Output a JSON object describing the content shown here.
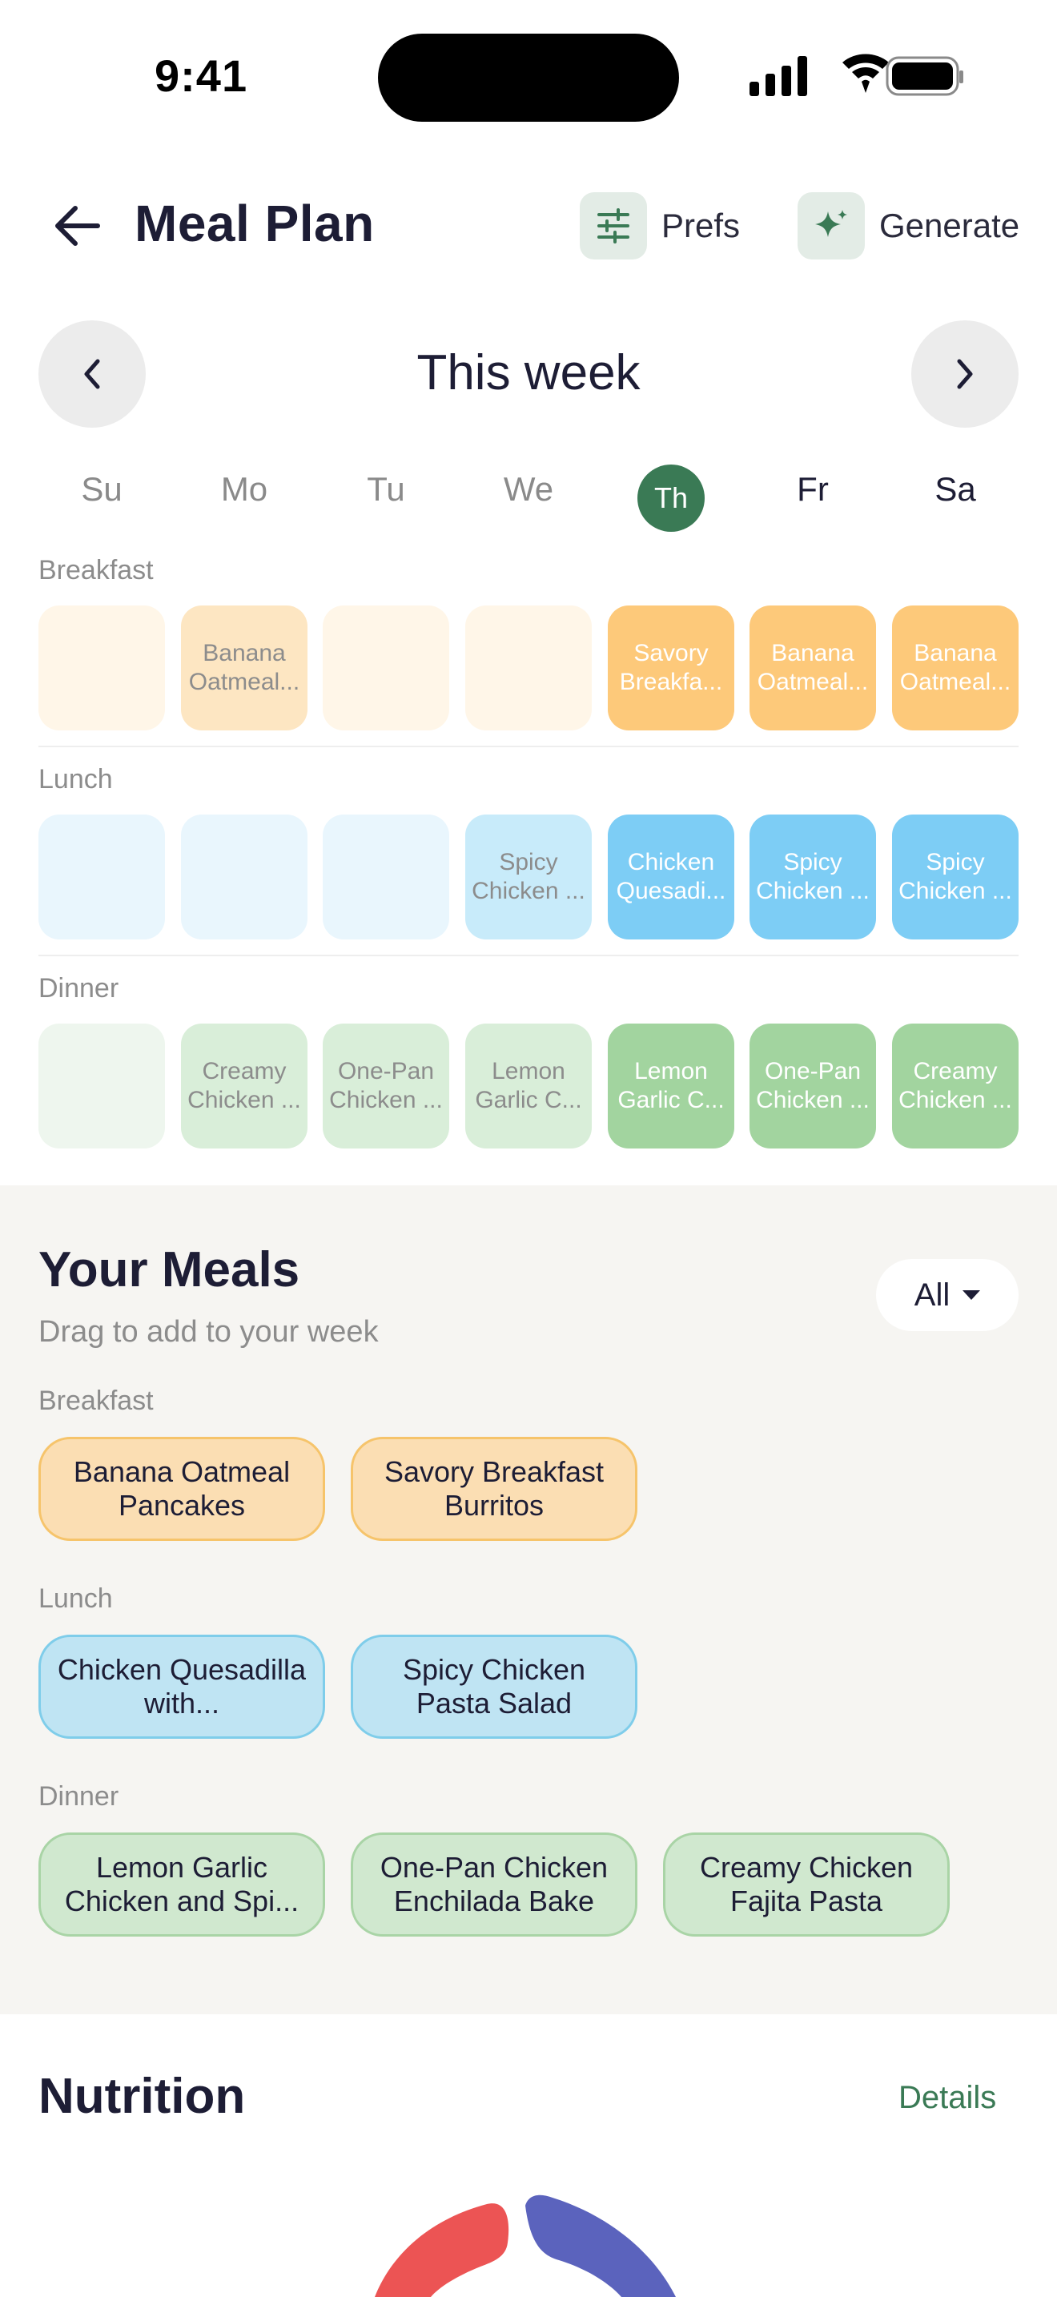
{
  "status_bar": {
    "time": "9:41"
  },
  "header": {
    "title": "Meal Plan",
    "prefs_label": "Prefs",
    "generate_label": "Generate"
  },
  "week": {
    "title": "This week",
    "days": [
      "Su",
      "Mo",
      "Tu",
      "We",
      "Th",
      "Fr",
      "Sa"
    ],
    "today": "Th"
  },
  "plan": {
    "breakfast": {
      "label": "Breakfast",
      "cells": [
        "",
        "Banana Oatmeal...",
        "",
        "",
        "Savory Breakfa...",
        "Banana Oatmeal...",
        "Banana Oatmeal..."
      ]
    },
    "lunch": {
      "label": "Lunch",
      "cells": [
        "",
        "",
        "",
        "Spicy Chicken ...",
        "Chicken Quesadi...",
        "Spicy Chicken ...",
        "Spicy Chicken ..."
      ]
    },
    "dinner": {
      "label": "Dinner",
      "cells": [
        "",
        "Creamy Chicken ...",
        "One-Pan Chicken ...",
        "Lemon Garlic C...",
        "Lemon Garlic C...",
        "One-Pan Chicken ...",
        "Creamy Chicken ..."
      ]
    }
  },
  "your_meals": {
    "title": "Your Meals",
    "subtitle": "Drag to add to your week",
    "filter": "All",
    "categories": [
      {
        "label": "Breakfast",
        "items": [
          "Banana Oatmeal Pancakes",
          "Savory Breakfast Burritos"
        ]
      },
      {
        "label": "Lunch",
        "items": [
          "Chicken Quesadilla with...",
          "Spicy Chicken Pasta Salad"
        ]
      },
      {
        "label": "Dinner",
        "items": [
          "Lemon Garlic Chicken and Spi...",
          "One-Pan Chicken Enchilada Bake",
          "Creamy Chicken Fajita Pasta"
        ]
      }
    ]
  },
  "nutrition": {
    "title": "Nutrition",
    "details_label": "Details"
  },
  "colors": {
    "accent": "#3a7a55",
    "breakfast_light": "#fff6e8",
    "breakfast_mid": "#fde6c2",
    "breakfast_full": "#fdc97a",
    "lunch_light": "#e9f6fd",
    "lunch_mid": "#c8ebfa",
    "lunch_full": "#7dcdf5",
    "dinner_light": "#eef6ee",
    "dinner_mid": "#d9eed9",
    "dinner_full": "#a2d49f",
    "chart_red": "#ec5454",
    "chart_blue": "#5b63bd"
  }
}
